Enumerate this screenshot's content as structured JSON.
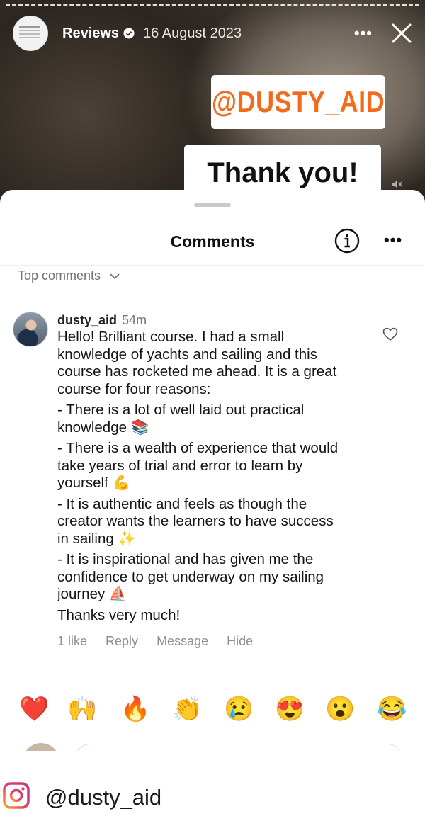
{
  "story": {
    "header": {
      "account_name": "Reviews",
      "date": "16 August 2023",
      "more_icon": "ellipsis-icon",
      "close_icon": "close-icon"
    },
    "tag_text": "@DUSTY_AID",
    "thank_text": "Thank you!"
  },
  "sheet": {
    "title": "Comments",
    "info_icon": "info-icon",
    "more_label": "•••",
    "sort_label": "Top comments"
  },
  "comment": {
    "username": "dusty_aid",
    "time": "54m",
    "lines": [
      "Hello! Brilliant course. I had a small",
      "knowledge of yachts and sailing and this",
      "course has rocketed me ahead. It is a great",
      "course for four reasons:",
      "- There is a lot of well laid out practical",
      "knowledge 📚",
      "- There is a wealth of experience that would",
      "take years of trial and error to learn by",
      "yourself 💪",
      "- It is authentic and feels as though the",
      "creator wants the learners to have success",
      "in sailing ✨",
      "- It is inspirational and has given me the",
      "confidence to get underway on my sailing",
      "journey ⛵",
      "Thanks very much!"
    ],
    "actions": {
      "likes": "1 like",
      "reply": "Reply",
      "message": "Message",
      "hide": "Hide"
    }
  },
  "emoji_reactions": [
    "❤️",
    "🙌",
    "🔥",
    "👏",
    "😢",
    "😍",
    "😮",
    "😂"
  ],
  "footer": {
    "handle": "@dusty_aid",
    "logo_icon": "instagram-icon"
  },
  "colors": {
    "tag_orange": "#f26a1b",
    "muted_text": "#737373",
    "action_text": "#8e8e8e"
  }
}
